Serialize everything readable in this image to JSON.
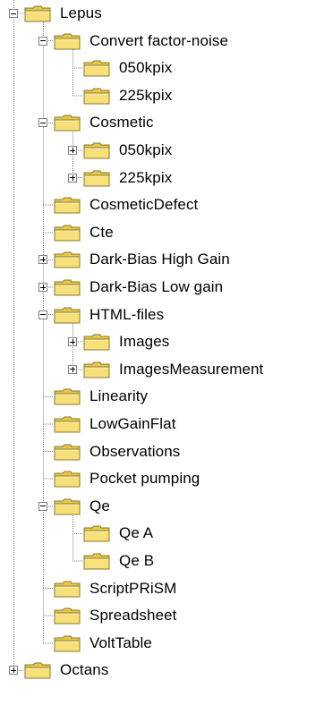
{
  "tree": {
    "nodes": [
      {
        "label": "Lepus",
        "depth": 0,
        "toggle": "minus"
      },
      {
        "label": "Convert factor-noise",
        "depth": 1,
        "toggle": "minus"
      },
      {
        "label": "050kpix",
        "depth": 2,
        "toggle": null
      },
      {
        "label": "225kpix",
        "depth": 2,
        "toggle": null
      },
      {
        "label": "Cosmetic",
        "depth": 1,
        "toggle": "minus"
      },
      {
        "label": "050kpix",
        "depth": 2,
        "toggle": "plus"
      },
      {
        "label": "225kpix",
        "depth": 2,
        "toggle": "plus"
      },
      {
        "label": "CosmeticDefect",
        "depth": 1,
        "toggle": null
      },
      {
        "label": "Cte",
        "depth": 1,
        "toggle": null
      },
      {
        "label": "Dark-Bias High Gain",
        "depth": 1,
        "toggle": "plus"
      },
      {
        "label": "Dark-Bias Low gain",
        "depth": 1,
        "toggle": "plus"
      },
      {
        "label": "HTML-files",
        "depth": 1,
        "toggle": "minus"
      },
      {
        "label": "Images",
        "depth": 2,
        "toggle": "plus"
      },
      {
        "label": "ImagesMeasurement",
        "depth": 2,
        "toggle": "plus"
      },
      {
        "label": "Linearity",
        "depth": 1,
        "toggle": null
      },
      {
        "label": "LowGainFlat",
        "depth": 1,
        "toggle": null
      },
      {
        "label": "Observations",
        "depth": 1,
        "toggle": null
      },
      {
        "label": "Pocket pumping",
        "depth": 1,
        "toggle": null
      },
      {
        "label": "Qe",
        "depth": 1,
        "toggle": "minus"
      },
      {
        "label": "Qe A",
        "depth": 2,
        "toggle": null
      },
      {
        "label": "Qe B",
        "depth": 2,
        "toggle": null
      },
      {
        "label": "ScriptPRiSM",
        "depth": 1,
        "toggle": null
      },
      {
        "label": "Spreadsheet",
        "depth": 1,
        "toggle": null
      },
      {
        "label": "VoltTable",
        "depth": 1,
        "toggle": null
      },
      {
        "label": "Octans",
        "depth": 0,
        "toggle": "plus"
      }
    ],
    "colors": {
      "folder_body": "#f7e07a",
      "folder_tab": "#e8c84a",
      "folder_outline": "#8a7a2a",
      "connector": "#808080"
    },
    "icon": "folder-icon"
  }
}
